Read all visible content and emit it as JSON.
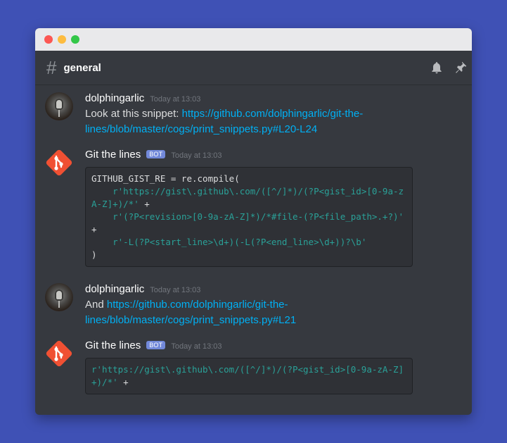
{
  "window": {
    "controls": [
      "close",
      "minimize",
      "maximize"
    ]
  },
  "header": {
    "hash": "#",
    "channel": "general",
    "icons": [
      "bell-icon",
      "pin-icon"
    ]
  },
  "messages": [
    {
      "author": "dolphingarlic",
      "time": "Today at 13:03",
      "text_prefix": "Look at this snippet: ",
      "link": "https://github.com/dolphingarlic/git-the-lines/blob/master/cogs/print_snippets.py#L20-L24"
    },
    {
      "author": "Git the lines",
      "badge": "BOT",
      "time": "Today at 13:03",
      "code_lines": [
        {
          "plain": "GITHUB_GIST_RE = re.compile("
        },
        {
          "indent": "    ",
          "str": "r'https://gist\\.github\\.com/([^/]*)/(?P<gist_id>[0-9a-zA-Z]+)/*'",
          "tail": " +"
        },
        {
          "indent": "    ",
          "str": "r'(?P<revision>[0-9a-zA-Z]*)/*#file-(?P<file_path>.+?)'",
          "tail": " +"
        },
        {
          "indent": "    ",
          "str": "r'-L(?P<start_line>\\d+)(-L(?P<end_line>\\d+))?\\b'",
          "tail": ""
        },
        {
          "plain": ")"
        }
      ]
    },
    {
      "author": "dolphingarlic",
      "time": "Today at 13:03",
      "text_prefix": "And ",
      "link": "https://github.com/dolphingarlic/git-the-lines/blob/master/cogs/print_snippets.py#L21"
    },
    {
      "author": "Git the lines",
      "badge": "BOT",
      "time": "Today at 13:03",
      "code_lines": [
        {
          "indent": "",
          "str": "r'https://gist\\.github\\.com/([^/]*)/(?P<gist_id>[0-9a-zA-Z]+)/*'",
          "tail": " +"
        }
      ]
    }
  ],
  "colors": {
    "background": "#3f51b5",
    "window": "#36393f",
    "link": "#00b0f4",
    "bot_badge": "#7289da",
    "code_string": "#2aa198",
    "git_logo": "#f05033"
  }
}
